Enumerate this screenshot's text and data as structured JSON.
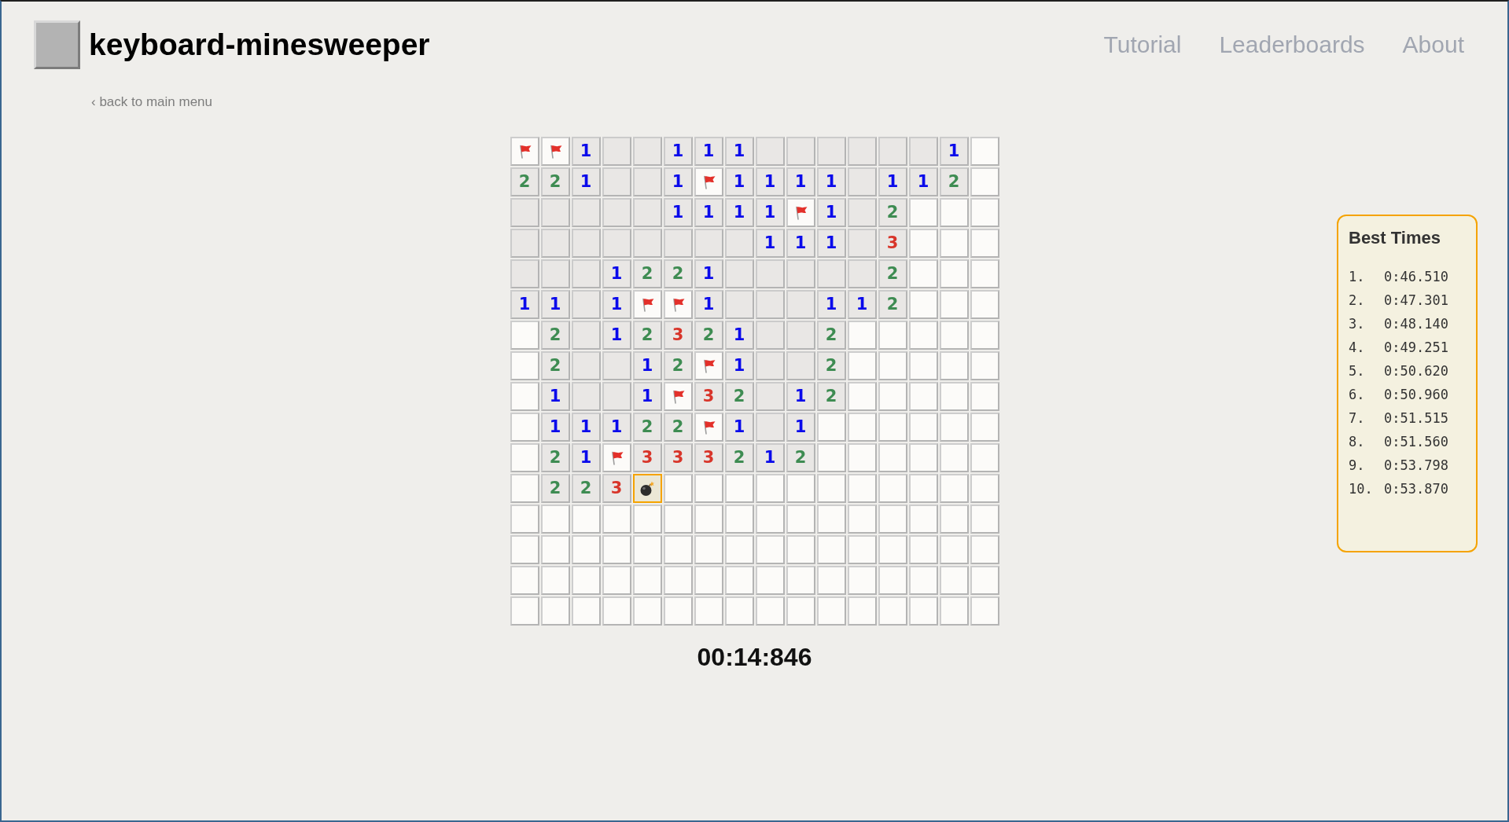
{
  "header": {
    "title": "keyboard-minesweeper",
    "nav": [
      {
        "label": "Tutorial"
      },
      {
        "label": "Leaderboards"
      },
      {
        "label": "About"
      }
    ]
  },
  "back_link": "‹ back to main menu",
  "board": {
    "rows": [
      [
        {
          "kind": "flag"
        },
        {
          "kind": "flag"
        },
        {
          "kind": "number",
          "text": "1",
          "color": "#0a0aeb"
        },
        {
          "kind": "open"
        },
        {
          "kind": "open"
        },
        {
          "kind": "number",
          "text": "1",
          "color": "#0a0aeb"
        },
        {
          "kind": "number",
          "text": "1",
          "color": "#0a0aeb"
        },
        {
          "kind": "number",
          "text": "1",
          "color": "#0a0aeb"
        },
        {
          "kind": "open"
        },
        {
          "kind": "open"
        },
        {
          "kind": "open"
        },
        {
          "kind": "open"
        },
        {
          "kind": "open"
        },
        {
          "kind": "open"
        },
        {
          "kind": "number",
          "text": "1",
          "color": "#0a0aeb"
        },
        {
          "kind": "covered"
        }
      ],
      [
        {
          "kind": "number",
          "text": "2",
          "color": "#3e8c52"
        },
        {
          "kind": "number",
          "text": "2",
          "color": "#3e8c52"
        },
        {
          "kind": "number",
          "text": "1",
          "color": "#0a0aeb"
        },
        {
          "kind": "open"
        },
        {
          "kind": "open"
        },
        {
          "kind": "number",
          "text": "1",
          "color": "#0a0aeb"
        },
        {
          "kind": "flag"
        },
        {
          "kind": "number",
          "text": "1",
          "color": "#0a0aeb"
        },
        {
          "kind": "number",
          "text": "1",
          "color": "#0a0aeb"
        },
        {
          "kind": "number",
          "text": "1",
          "color": "#0a0aeb"
        },
        {
          "kind": "number",
          "text": "1",
          "color": "#0a0aeb"
        },
        {
          "kind": "open"
        },
        {
          "kind": "number",
          "text": "1",
          "color": "#0a0aeb"
        },
        {
          "kind": "number",
          "text": "1",
          "color": "#0a0aeb"
        },
        {
          "kind": "number",
          "text": "2",
          "color": "#3e8c52"
        },
        {
          "kind": "covered"
        }
      ],
      [
        {
          "kind": "open"
        },
        {
          "kind": "open"
        },
        {
          "kind": "open"
        },
        {
          "kind": "open"
        },
        {
          "kind": "open"
        },
        {
          "kind": "number",
          "text": "1",
          "color": "#0a0aeb"
        },
        {
          "kind": "number",
          "text": "1",
          "color": "#0a0aeb"
        },
        {
          "kind": "number",
          "text": "1",
          "color": "#0a0aeb"
        },
        {
          "kind": "number",
          "text": "1",
          "color": "#0a0aeb"
        },
        {
          "kind": "flag"
        },
        {
          "kind": "number",
          "text": "1",
          "color": "#0a0aeb"
        },
        {
          "kind": "open"
        },
        {
          "kind": "number",
          "text": "2",
          "color": "#3e8c52"
        },
        {
          "kind": "covered"
        },
        {
          "kind": "covered"
        },
        {
          "kind": "covered"
        }
      ],
      [
        {
          "kind": "open"
        },
        {
          "kind": "open"
        },
        {
          "kind": "open"
        },
        {
          "kind": "open"
        },
        {
          "kind": "open"
        },
        {
          "kind": "open"
        },
        {
          "kind": "open"
        },
        {
          "kind": "open"
        },
        {
          "kind": "number",
          "text": "1",
          "color": "#0a0aeb"
        },
        {
          "kind": "number",
          "text": "1",
          "color": "#0a0aeb"
        },
        {
          "kind": "number",
          "text": "1",
          "color": "#0a0aeb"
        },
        {
          "kind": "open"
        },
        {
          "kind": "number",
          "text": "3",
          "color": "#d8352a"
        },
        {
          "kind": "covered"
        },
        {
          "kind": "covered"
        },
        {
          "kind": "covered"
        }
      ],
      [
        {
          "kind": "open"
        },
        {
          "kind": "open"
        },
        {
          "kind": "open"
        },
        {
          "kind": "number",
          "text": "1",
          "color": "#0a0aeb"
        },
        {
          "kind": "number",
          "text": "2",
          "color": "#3e8c52"
        },
        {
          "kind": "number",
          "text": "2",
          "color": "#3e8c52"
        },
        {
          "kind": "number",
          "text": "1",
          "color": "#0a0aeb"
        },
        {
          "kind": "open"
        },
        {
          "kind": "open"
        },
        {
          "kind": "open"
        },
        {
          "kind": "open"
        },
        {
          "kind": "open"
        },
        {
          "kind": "number",
          "text": "2",
          "color": "#3e8c52"
        },
        {
          "kind": "covered"
        },
        {
          "kind": "covered"
        },
        {
          "kind": "covered"
        }
      ],
      [
        {
          "kind": "number",
          "text": "1",
          "color": "#0a0aeb"
        },
        {
          "kind": "number",
          "text": "1",
          "color": "#0a0aeb"
        },
        {
          "kind": "open"
        },
        {
          "kind": "number",
          "text": "1",
          "color": "#0a0aeb"
        },
        {
          "kind": "flag"
        },
        {
          "kind": "flag"
        },
        {
          "kind": "number",
          "text": "1",
          "color": "#0a0aeb"
        },
        {
          "kind": "open"
        },
        {
          "kind": "open"
        },
        {
          "kind": "open"
        },
        {
          "kind": "number",
          "text": "1",
          "color": "#0a0aeb"
        },
        {
          "kind": "number",
          "text": "1",
          "color": "#0a0aeb"
        },
        {
          "kind": "number",
          "text": "2",
          "color": "#3e8c52"
        },
        {
          "kind": "covered"
        },
        {
          "kind": "covered"
        },
        {
          "kind": "covered"
        }
      ],
      [
        {
          "kind": "covered"
        },
        {
          "kind": "number",
          "text": "2",
          "color": "#3e8c52"
        },
        {
          "kind": "open"
        },
        {
          "kind": "number",
          "text": "1",
          "color": "#0a0aeb"
        },
        {
          "kind": "number",
          "text": "2",
          "color": "#3e8c52"
        },
        {
          "kind": "number",
          "text": "3",
          "color": "#d8352a"
        },
        {
          "kind": "number",
          "text": "2",
          "color": "#3e8c52"
        },
        {
          "kind": "number",
          "text": "1",
          "color": "#0a0aeb"
        },
        {
          "kind": "open"
        },
        {
          "kind": "open"
        },
        {
          "kind": "number",
          "text": "2",
          "color": "#3e8c52"
        },
        {
          "kind": "covered"
        },
        {
          "kind": "covered"
        },
        {
          "kind": "covered"
        },
        {
          "kind": "covered"
        },
        {
          "kind": "covered"
        }
      ],
      [
        {
          "kind": "covered"
        },
        {
          "kind": "number",
          "text": "2",
          "color": "#3e8c52"
        },
        {
          "kind": "open"
        },
        {
          "kind": "open"
        },
        {
          "kind": "number",
          "text": "1",
          "color": "#0a0aeb"
        },
        {
          "kind": "number",
          "text": "2",
          "color": "#3e8c52"
        },
        {
          "kind": "flag"
        },
        {
          "kind": "number",
          "text": "1",
          "color": "#0a0aeb"
        },
        {
          "kind": "open"
        },
        {
          "kind": "open"
        },
        {
          "kind": "number",
          "text": "2",
          "color": "#3e8c52"
        },
        {
          "kind": "covered"
        },
        {
          "kind": "covered"
        },
        {
          "kind": "covered"
        },
        {
          "kind": "covered"
        },
        {
          "kind": "covered"
        }
      ],
      [
        {
          "kind": "covered"
        },
        {
          "kind": "number",
          "text": "1",
          "color": "#0a0aeb"
        },
        {
          "kind": "open"
        },
        {
          "kind": "open"
        },
        {
          "kind": "number",
          "text": "1",
          "color": "#0a0aeb"
        },
        {
          "kind": "flag"
        },
        {
          "kind": "number",
          "text": "3",
          "color": "#d8352a"
        },
        {
          "kind": "number",
          "text": "2",
          "color": "#3e8c52"
        },
        {
          "kind": "open"
        },
        {
          "kind": "number",
          "text": "1",
          "color": "#0a0aeb"
        },
        {
          "kind": "number",
          "text": "2",
          "color": "#3e8c52"
        },
        {
          "kind": "covered"
        },
        {
          "kind": "covered"
        },
        {
          "kind": "covered"
        },
        {
          "kind": "covered"
        },
        {
          "kind": "covered"
        }
      ],
      [
        {
          "kind": "covered"
        },
        {
          "kind": "number",
          "text": "1",
          "color": "#0a0aeb"
        },
        {
          "kind": "number",
          "text": "1",
          "color": "#0a0aeb"
        },
        {
          "kind": "number",
          "text": "1",
          "color": "#0a0aeb"
        },
        {
          "kind": "number",
          "text": "2",
          "color": "#3e8c52"
        },
        {
          "kind": "number",
          "text": "2",
          "color": "#3e8c52"
        },
        {
          "kind": "flag"
        },
        {
          "kind": "number",
          "text": "1",
          "color": "#0a0aeb"
        },
        {
          "kind": "open"
        },
        {
          "kind": "number",
          "text": "1",
          "color": "#0a0aeb"
        },
        {
          "kind": "covered"
        },
        {
          "kind": "covered"
        },
        {
          "kind": "covered"
        },
        {
          "kind": "covered"
        },
        {
          "kind": "covered"
        },
        {
          "kind": "covered"
        }
      ],
      [
        {
          "kind": "covered"
        },
        {
          "kind": "number",
          "text": "2",
          "color": "#3e8c52"
        },
        {
          "kind": "number",
          "text": "1",
          "color": "#0a0aeb"
        },
        {
          "kind": "flag"
        },
        {
          "kind": "number",
          "text": "3",
          "color": "#d8352a"
        },
        {
          "kind": "number",
          "text": "3",
          "color": "#d8352a"
        },
        {
          "kind": "number",
          "text": "3",
          "color": "#d8352a"
        },
        {
          "kind": "number",
          "text": "2",
          "color": "#3e8c52"
        },
        {
          "kind": "number",
          "text": "1",
          "color": "#0a0aeb"
        },
        {
          "kind": "number",
          "text": "2",
          "color": "#3e8c52"
        },
        {
          "kind": "covered"
        },
        {
          "kind": "covered"
        },
        {
          "kind": "covered"
        },
        {
          "kind": "covered"
        },
        {
          "kind": "covered"
        },
        {
          "kind": "covered"
        }
      ],
      [
        {
          "kind": "covered"
        },
        {
          "kind": "number",
          "text": "2",
          "color": "#3e8c52"
        },
        {
          "kind": "number",
          "text": "2",
          "color": "#3e8c52"
        },
        {
          "kind": "number",
          "text": "3",
          "color": "#d8352a"
        },
        {
          "kind": "mine"
        },
        {
          "kind": "covered"
        },
        {
          "kind": "covered"
        },
        {
          "kind": "covered"
        },
        {
          "kind": "covered"
        },
        {
          "kind": "covered"
        },
        {
          "kind": "covered"
        },
        {
          "kind": "covered"
        },
        {
          "kind": "covered"
        },
        {
          "kind": "covered"
        },
        {
          "kind": "covered"
        },
        {
          "kind": "covered"
        }
      ],
      [
        {
          "kind": "covered"
        },
        {
          "kind": "covered"
        },
        {
          "kind": "covered"
        },
        {
          "kind": "covered"
        },
        {
          "kind": "covered"
        },
        {
          "kind": "covered"
        },
        {
          "kind": "covered"
        },
        {
          "kind": "covered"
        },
        {
          "kind": "covered"
        },
        {
          "kind": "covered"
        },
        {
          "kind": "covered"
        },
        {
          "kind": "covered"
        },
        {
          "kind": "covered"
        },
        {
          "kind": "covered"
        },
        {
          "kind": "covered"
        },
        {
          "kind": "covered"
        }
      ],
      [
        {
          "kind": "covered"
        },
        {
          "kind": "covered"
        },
        {
          "kind": "covered"
        },
        {
          "kind": "covered"
        },
        {
          "kind": "covered"
        },
        {
          "kind": "covered"
        },
        {
          "kind": "covered"
        },
        {
          "kind": "covered"
        },
        {
          "kind": "covered"
        },
        {
          "kind": "covered"
        },
        {
          "kind": "covered"
        },
        {
          "kind": "covered"
        },
        {
          "kind": "covered"
        },
        {
          "kind": "covered"
        },
        {
          "kind": "covered"
        },
        {
          "kind": "covered"
        }
      ],
      [
        {
          "kind": "covered"
        },
        {
          "kind": "covered"
        },
        {
          "kind": "covered"
        },
        {
          "kind": "covered"
        },
        {
          "kind": "covered"
        },
        {
          "kind": "covered"
        },
        {
          "kind": "covered"
        },
        {
          "kind": "covered"
        },
        {
          "kind": "covered"
        },
        {
          "kind": "covered"
        },
        {
          "kind": "covered"
        },
        {
          "kind": "covered"
        },
        {
          "kind": "covered"
        },
        {
          "kind": "covered"
        },
        {
          "kind": "covered"
        },
        {
          "kind": "covered"
        }
      ],
      [
        {
          "kind": "covered"
        },
        {
          "kind": "covered"
        },
        {
          "kind": "covered"
        },
        {
          "kind": "covered"
        },
        {
          "kind": "covered"
        },
        {
          "kind": "covered"
        },
        {
          "kind": "covered"
        },
        {
          "kind": "covered"
        },
        {
          "kind": "covered"
        },
        {
          "kind": "covered"
        },
        {
          "kind": "covered"
        },
        {
          "kind": "covered"
        },
        {
          "kind": "covered"
        },
        {
          "kind": "covered"
        },
        {
          "kind": "covered"
        },
        {
          "kind": "covered"
        }
      ]
    ]
  },
  "timer": "00:14:846",
  "best_times": {
    "title": "Best Times",
    "entries": [
      {
        "rank": "1.",
        "time": "0:46.510"
      },
      {
        "rank": "2.",
        "time": "0:47.301"
      },
      {
        "rank": "3.",
        "time": "0:48.140"
      },
      {
        "rank": "4.",
        "time": "0:49.251"
      },
      {
        "rank": "5.",
        "time": "0:50.620"
      },
      {
        "rank": "6.",
        "time": "0:50.960"
      },
      {
        "rank": "7.",
        "time": "0:51.515"
      },
      {
        "rank": "8.",
        "time": "0:51.560"
      },
      {
        "rank": "9.",
        "time": "0:53.798"
      },
      {
        "rank": "10.",
        "time": "0:53.870"
      }
    ]
  }
}
